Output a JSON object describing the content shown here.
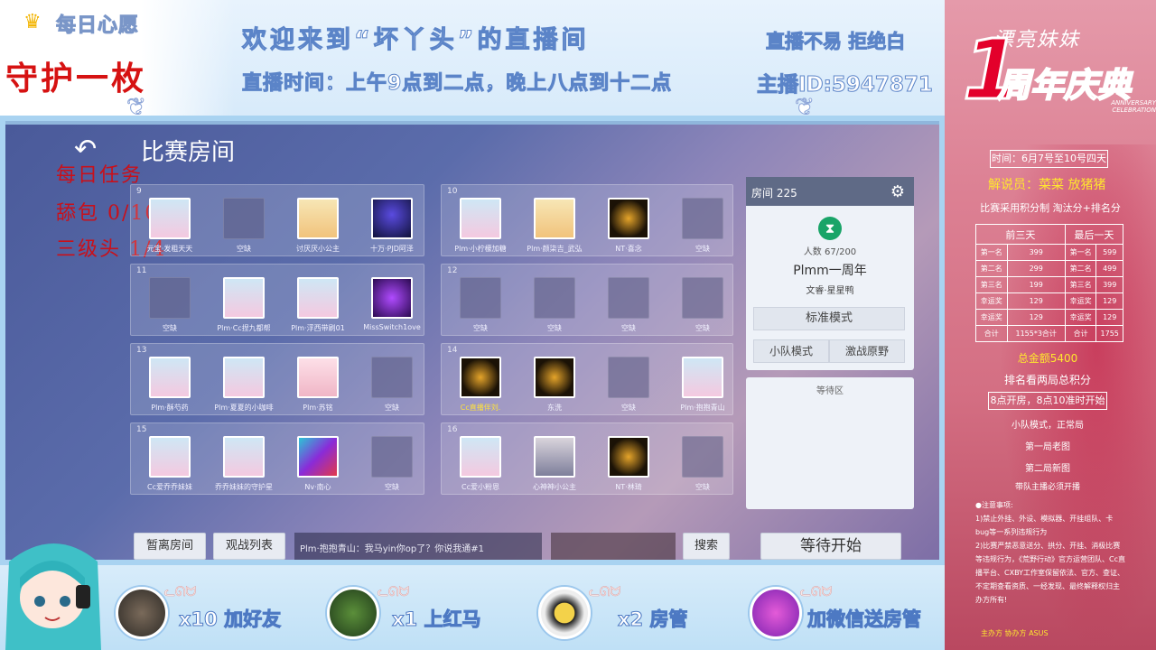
{
  "header": {
    "daily_wish": "每日心愿",
    "guard": "守护一枚",
    "welcome": "欢迎来到“坏丫头”的直播间",
    "schedule": "直播时间：上午9点到二点，晚上八点到十二点",
    "slogan": "直播不易 拒绝白",
    "host_id": "主播ID:5947871"
  },
  "game": {
    "title": "比赛房间",
    "tasks": [
      "每日任务",
      "舔包 0/100",
      "三级头 1/4"
    ],
    "panels": [
      {
        "room": "9",
        "players": [
          {
            "name": "元宝·发粗天天",
            "avatar": "pink"
          },
          {
            "name": "空缺",
            "avatar": "empty"
          },
          {
            "name": "讨厌厌小公主",
            "avatar": "blond"
          },
          {
            "name": "十万·PJD阿泽",
            "avatar": "dark"
          }
        ]
      },
      {
        "room": "10",
        "players": [
          {
            "name": "Plm·小柠檬加糖",
            "avatar": "pink"
          },
          {
            "name": "Plm·颜柒吉_武弘",
            "avatar": "blond"
          },
          {
            "name": "NT·喜念",
            "avatar": "gold"
          },
          {
            "name": "空缺",
            "avatar": "empty"
          }
        ]
      },
      {
        "room": "11",
        "players": [
          {
            "name": "空缺",
            "avatar": "empty"
          },
          {
            "name": "Plm·Cc捏九都帮",
            "avatar": "pink"
          },
          {
            "name": "Plm·浮西带刷01",
            "avatar": "pink"
          },
          {
            "name": "MissSwitch1ove",
            "avatar": "purple"
          }
        ]
      },
      {
        "room": "12",
        "players": [
          {
            "name": "空缺",
            "avatar": "empty"
          },
          {
            "name": "空缺",
            "avatar": "empty"
          },
          {
            "name": "空缺",
            "avatar": "empty"
          },
          {
            "name": "空缺",
            "avatar": "empty"
          }
        ]
      },
      {
        "room": "13",
        "players": [
          {
            "name": "Plm·酥芍药",
            "avatar": "pink"
          },
          {
            "name": "Plm·夏夏的小咖啡",
            "avatar": "pink"
          },
          {
            "name": "Plm·苏铭",
            "avatar": "soft"
          },
          {
            "name": "空缺",
            "avatar": "empty"
          }
        ]
      },
      {
        "room": "14",
        "players": [
          {
            "name": "Cc直播伴刘.",
            "avatar": "gold",
            "highlight": true
          },
          {
            "name": "东洗",
            "avatar": "gold"
          },
          {
            "name": "空缺",
            "avatar": "empty"
          },
          {
            "name": "Plm·抱抱青山",
            "avatar": "pink"
          }
        ]
      },
      {
        "room": "15",
        "players": [
          {
            "name": "Cc爱乔乔妹妹",
            "avatar": "pink"
          },
          {
            "name": "乔乔妹妹的守护星",
            "avatar": "pink"
          },
          {
            "name": "Nv·南心",
            "avatar": "multi"
          },
          {
            "name": "空缺",
            "avatar": "empty"
          }
        ]
      },
      {
        "room": "16",
        "players": [
          {
            "name": "Cc爱小粉恩",
            "avatar": "pink"
          },
          {
            "name": "心神神小公主",
            "avatar": "photo"
          },
          {
            "name": "NT·林琦",
            "avatar": "gold"
          },
          {
            "name": "空缺",
            "avatar": "empty"
          }
        ]
      }
    ],
    "room": {
      "label": "房间 225",
      "count": "人数 67/200",
      "name": "Plmm一周年",
      "host": "文睿·星星鸭",
      "mode_standard": "标准模式",
      "mode_team": "小队模式",
      "mode_wild": "激战原野"
    },
    "waiting_area": "等待区",
    "buttons": {
      "leave": "暂离房间",
      "spectators": "观战列表",
      "search": "搜索",
      "wait_start": "等待开始"
    },
    "chat_line": "Plm·抱抱青山：我马yin你op了？你说我通#1"
  },
  "gifts": [
    {
      "label": "x10 加好友"
    },
    {
      "label": "x1 上红马"
    },
    {
      "label": "x2 房管"
    },
    {
      "label": "加微信送房管"
    }
  ],
  "sidebar": {
    "beauty": "漂亮妹妹",
    "big_one": "1",
    "anniversary": "周年庆典",
    "celebration": "ANNIVERSARY CELEBRATION",
    "date": "时间：6月7号至10号四天",
    "commentator_label": "解说员：",
    "commentators": "菜菜  放猪猪",
    "scoring": "比赛采用积分制 淘汰分+排名分",
    "table": {
      "headers": [
        "前三天",
        "最后一天"
      ],
      "rows": [
        [
          "第一名",
          "399",
          "第一名",
          "599"
        ],
        [
          "第二名",
          "299",
          "第二名",
          "499"
        ],
        [
          "第三名",
          "199",
          "第三名",
          "399"
        ],
        [
          "幸运奖",
          "129",
          "幸运奖",
          "129"
        ],
        [
          "幸运奖",
          "129",
          "幸运奖",
          "129"
        ],
        [
          "合计",
          "1155*3合计",
          "合计",
          "1755"
        ]
      ]
    },
    "total": "总金额5400",
    "ranking": "排名看两局总积分",
    "open_time": "8点开房，8点10准时开始",
    "mode_info": "小队模式，正常局",
    "round1": "第一局老图",
    "round2": "第二局新图",
    "captain": "带队主播必须开播",
    "rules": [
      "●注意事项:",
      "1)禁止外挂、外设、模拟器、开挂组队、卡bug等一系列违规行为",
      "2)比赛严禁恶意送分、拱分、开挂、消极比赛等违规行为，《荒野行动》官方运营团队、Cc直播平台、CXBY工作室保留依法、官方、查证、不定期查看资质、一经发现、最终解释权归主办方所有!"
    ],
    "footer": "主办方  协办方  ASUS"
  }
}
